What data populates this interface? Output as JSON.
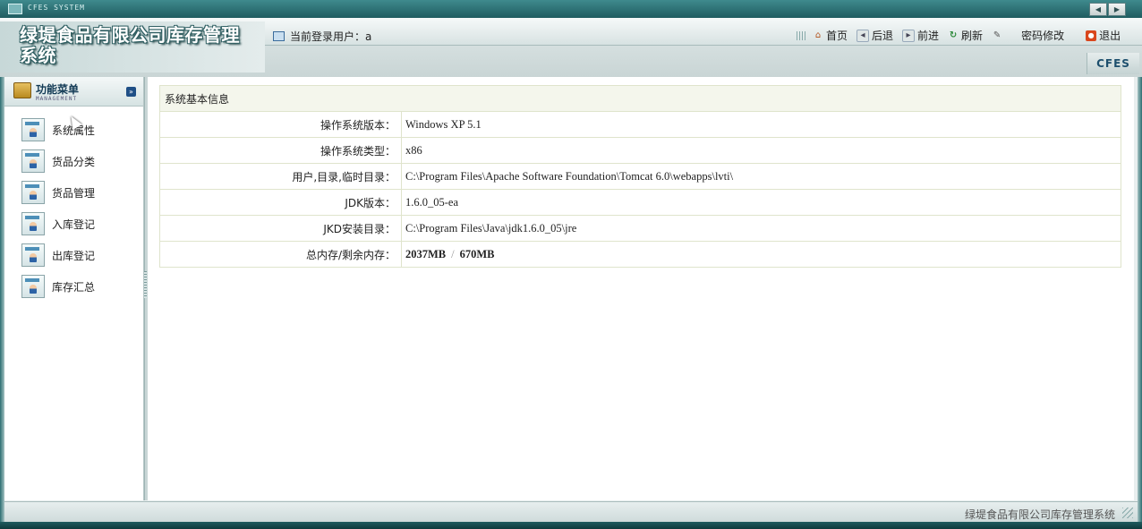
{
  "window": {
    "title": "CFES SYSTEM",
    "btn_prev": "◀",
    "btn_next": "▶"
  },
  "header": {
    "brand_line1": "绿堤食品有限公司库存管理",
    "brand_line2": "系统",
    "user_label": "当前登录用户：a",
    "badge": "CFES",
    "nav": [
      {
        "label": "首页",
        "icon": "home-icon"
      },
      {
        "label": "后退",
        "icon": "back-icon"
      },
      {
        "label": "前进",
        "icon": "forward-icon"
      },
      {
        "label": "刷新",
        "icon": "refresh-icon"
      },
      {
        "label": "密码修改",
        "icon": "edit-icon"
      },
      {
        "label": "退出",
        "icon": "exit-icon"
      }
    ]
  },
  "sidebar": {
    "title": "功能菜单",
    "subtitle": "MANAGEMENT",
    "items": [
      {
        "label": "系统属性"
      },
      {
        "label": "货品分类"
      },
      {
        "label": "货品管理"
      },
      {
        "label": "入库登记"
      },
      {
        "label": "出库登记"
      },
      {
        "label": "库存汇总"
      }
    ]
  },
  "info": {
    "heading": "系统基本信息",
    "rows": [
      {
        "label": "操作系统版本：",
        "value": "Windows XP  5.1"
      },
      {
        "label": "操作系统类型：",
        "value": "x86"
      },
      {
        "label": "用户,目录,临时目录：",
        "value": "C:\\Program Files\\Apache Software Foundation\\Tomcat 6.0\\webapps\\lvti\\"
      },
      {
        "label": "JDK版本：",
        "value": "1.6.0_05-ea"
      },
      {
        "label": "JKD安装目录：",
        "value": "C:\\Program Files\\Java\\jdk1.6.0_05\\jre"
      }
    ],
    "memory_label": "总内存/剩余内存：",
    "memory_total": "2037MB",
    "memory_sep": "/",
    "memory_free": "670MB"
  },
  "status": {
    "text": "绿堤食品有限公司库存管理系统"
  }
}
